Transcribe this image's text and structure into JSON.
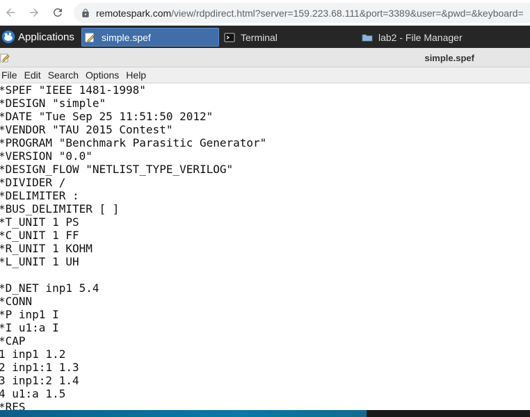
{
  "browser": {
    "url_host": "remotespark.com",
    "url_path": "/view/rdpdirect.html?server=159.223.68.111&port=3389&user=&pwd=&keyboard="
  },
  "panel": {
    "applications_label": "Applications",
    "tasks": [
      {
        "label": "simple.spef",
        "icon": "text-editor-icon",
        "active": true
      },
      {
        "label": "Terminal",
        "icon": "terminal-icon",
        "active": false
      },
      {
        "label": "lab2 - File Manager",
        "icon": "folder-icon",
        "active": false
      }
    ]
  },
  "window": {
    "title": "simple.spef"
  },
  "menubar": {
    "items": [
      "File",
      "Edit",
      "Search",
      "Options",
      "Help"
    ]
  },
  "editor": {
    "lines": [
      "*SPEF \"IEEE 1481-1998\"",
      "*DESIGN \"simple\"",
      "*DATE \"Tue Sep 25 11:51:50 2012\"",
      "*VENDOR \"TAU 2015 Contest\"",
      "*PROGRAM \"Benchmark Parasitic Generator\"",
      "*VERSION \"0.0\"",
      "*DESIGN_FLOW \"NETLIST_TYPE_VERILOG\"",
      "*DIVIDER /",
      "*DELIMITER :",
      "*BUS_DELIMITER [ ]",
      "*T_UNIT 1 PS",
      "*C_UNIT 1 FF",
      "*R_UNIT 1 KOHM",
      "*L_UNIT 1 UH",
      "",
      "*D_NET inp1 5.4",
      "*CONN",
      "*P inp1 I",
      "*I u1:a I",
      "*CAP",
      "1 inp1 1.2",
      "2 inp1:1 1.3",
      "3 inp1:2 1.4",
      "4 u1:a 1.5",
      "*RES"
    ]
  }
}
